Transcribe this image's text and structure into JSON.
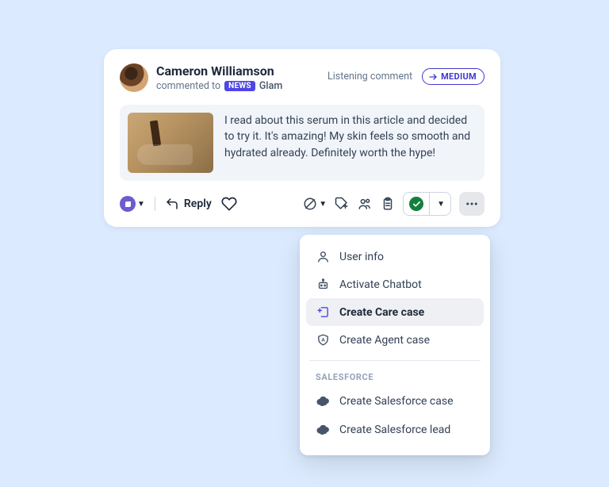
{
  "header": {
    "author_name": "Cameron Williamson",
    "commented_to_label": "commented to",
    "news_badge": "NEWS",
    "source_name": "Glam",
    "listening_label": "Listening comment",
    "priority_label": "MEDIUM"
  },
  "content": {
    "comment_text": "I read about this serum in this article and decided to try it. It's amazing! My skin feels so smooth and hydrated already. Definitely worth the hype!"
  },
  "actions": {
    "reply_label": "Reply"
  },
  "dropdown": {
    "items": [
      {
        "label": "User info"
      },
      {
        "label": "Activate Chatbot"
      },
      {
        "label": "Create Care case"
      },
      {
        "label": "Create Agent case"
      }
    ],
    "section_heading": "SALESFORCE",
    "sf_items": [
      {
        "label": "Create Salesforce case"
      },
      {
        "label": "Create Salesforce lead"
      }
    ]
  }
}
